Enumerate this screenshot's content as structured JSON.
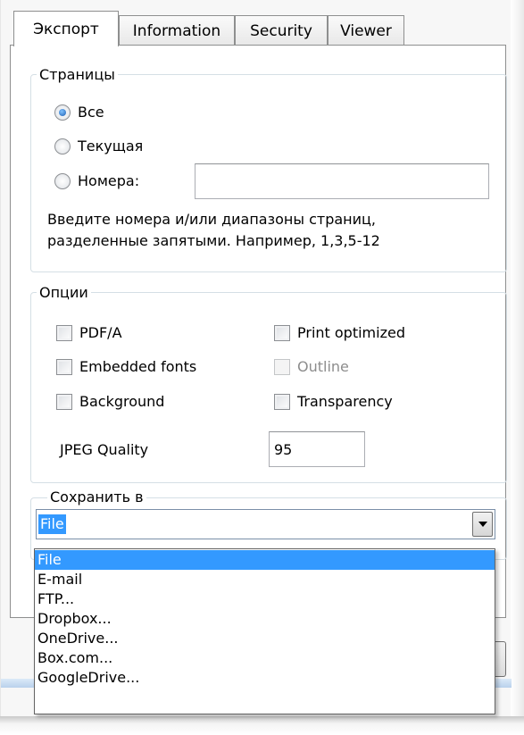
{
  "tabs": [
    "Экспорт",
    "Information",
    "Security",
    "Viewer"
  ],
  "pages_group": {
    "title": "Страницы",
    "options": [
      "Все",
      "Текущая",
      "Номера:"
    ],
    "selected": "Все",
    "numbers_value": "",
    "hint_line1": "Введите номера и/или диапазоны страниц,",
    "hint_line2": "разделенные запятыми. Например, 1,3,5-12"
  },
  "options_group": {
    "title": "Опции",
    "pdfa": "PDF/A",
    "print_optimized": "Print optimized",
    "embedded_fonts": "Embedded fonts",
    "outline": "Outline",
    "background": "Background",
    "transparency": "Transparency",
    "jpeg_label": "JPEG Quality",
    "jpeg_value": "95"
  },
  "save_group": {
    "title": "Сохранить в",
    "selected": "File",
    "options": [
      "File",
      "E-mail",
      "FTP...",
      "Dropbox...",
      "OneDrive...",
      "Box.com...",
      "GoogleDrive..."
    ]
  },
  "icons": {
    "combo_arrow": "chevron-down-icon"
  },
  "colors": {
    "selection": "#3399ff",
    "border": "#8e8f8f"
  }
}
